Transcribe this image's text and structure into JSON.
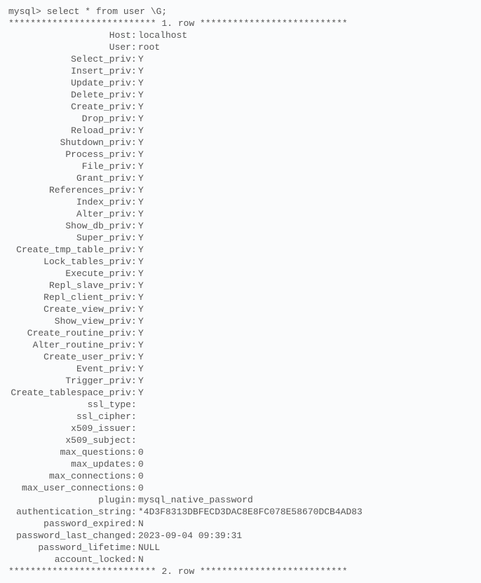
{
  "prompt": "mysql> select * from user \\G;",
  "separator_prefix": "*************************** ",
  "separator_suffix": " ***************************",
  "row1_label": "1. row",
  "row2_label": "2. row",
  "fields": [
    {
      "name": "Host",
      "value": "localhost"
    },
    {
      "name": "User",
      "value": "root"
    },
    {
      "name": "Select_priv",
      "value": "Y"
    },
    {
      "name": "Insert_priv",
      "value": "Y"
    },
    {
      "name": "Update_priv",
      "value": "Y"
    },
    {
      "name": "Delete_priv",
      "value": "Y"
    },
    {
      "name": "Create_priv",
      "value": "Y"
    },
    {
      "name": "Drop_priv",
      "value": "Y"
    },
    {
      "name": "Reload_priv",
      "value": "Y"
    },
    {
      "name": "Shutdown_priv",
      "value": "Y"
    },
    {
      "name": "Process_priv",
      "value": "Y"
    },
    {
      "name": "File_priv",
      "value": "Y"
    },
    {
      "name": "Grant_priv",
      "value": "Y"
    },
    {
      "name": "References_priv",
      "value": "Y"
    },
    {
      "name": "Index_priv",
      "value": "Y"
    },
    {
      "name": "Alter_priv",
      "value": "Y"
    },
    {
      "name": "Show_db_priv",
      "value": "Y"
    },
    {
      "name": "Super_priv",
      "value": "Y"
    },
    {
      "name": "Create_tmp_table_priv",
      "value": "Y"
    },
    {
      "name": "Lock_tables_priv",
      "value": "Y"
    },
    {
      "name": "Execute_priv",
      "value": "Y"
    },
    {
      "name": "Repl_slave_priv",
      "value": "Y"
    },
    {
      "name": "Repl_client_priv",
      "value": "Y"
    },
    {
      "name": "Create_view_priv",
      "value": "Y"
    },
    {
      "name": "Show_view_priv",
      "value": "Y"
    },
    {
      "name": "Create_routine_priv",
      "value": "Y"
    },
    {
      "name": "Alter_routine_priv",
      "value": "Y"
    },
    {
      "name": "Create_user_priv",
      "value": "Y"
    },
    {
      "name": "Event_priv",
      "value": "Y"
    },
    {
      "name": "Trigger_priv",
      "value": "Y"
    },
    {
      "name": "Create_tablespace_priv",
      "value": "Y"
    },
    {
      "name": "ssl_type",
      "value": ""
    },
    {
      "name": "ssl_cipher",
      "value": ""
    },
    {
      "name": "x509_issuer",
      "value": ""
    },
    {
      "name": "x509_subject",
      "value": ""
    },
    {
      "name": "max_questions",
      "value": "0"
    },
    {
      "name": "max_updates",
      "value": "0"
    },
    {
      "name": "max_connections",
      "value": "0"
    },
    {
      "name": "max_user_connections",
      "value": "0"
    },
    {
      "name": "plugin",
      "value": "mysql_native_password"
    },
    {
      "name": "authentication_string",
      "value": "*4D3F8313DBFECD3DAC8E8FC078E58670DCB4AD83"
    },
    {
      "name": "password_expired",
      "value": "N"
    },
    {
      "name": "password_last_changed",
      "value": "2023-09-04 09:39:31"
    },
    {
      "name": "password_lifetime",
      "value": "NULL"
    },
    {
      "name": "account_locked",
      "value": "N"
    }
  ]
}
